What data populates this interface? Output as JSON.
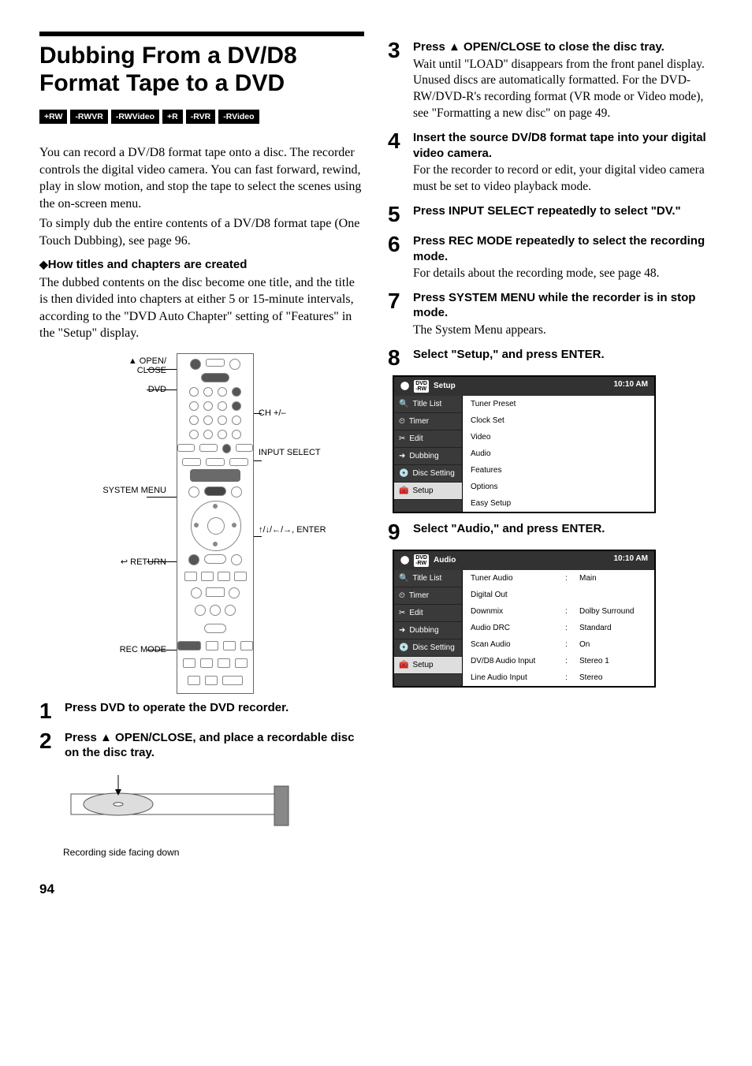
{
  "title": "Dubbing From a DV/D8 Format Tape to a DVD",
  "formats": [
    "+RW",
    "-RWVR",
    "-RWVideo",
    "+R",
    "-RVR",
    "-RVideo"
  ],
  "intro_p1": "You can record a DV/D8 format tape onto a disc. The recorder controls the digital video camera. You can fast forward, rewind, play in slow motion, and stop the tape to select the scenes using the on-screen menu.",
  "intro_p2": "To simply dub the entire contents of a DV/D8 format tape (One Touch Dubbing), see page 96.",
  "sub_heading": "How titles and chapters are created",
  "sub_text": "The dubbed contents on the disc become one title, and the title is then divided into chapters at either 5 or 15-minute intervals, according to the \"DVD Auto Chapter\" setting of \"Features\" in the \"Setup\" display.",
  "remote_labels": {
    "open_close": "OPEN/\nCLOSE",
    "dvd": "DVD",
    "ch": "CH +/–",
    "input_select": "INPUT SELECT",
    "system_menu": "SYSTEM MENU",
    "enter": "↑/↓/←/→, ENTER",
    "return": "RETURN",
    "rec_mode": "REC MODE"
  },
  "steps": {
    "s1": {
      "n": "1",
      "t": "Press DVD to operate the DVD recorder."
    },
    "s2": {
      "n": "2",
      "t": "Press ▲ OPEN/CLOSE, and place a recordable disc on the disc tray."
    },
    "s3": {
      "n": "3",
      "t": "Press ▲ OPEN/CLOSE to close the disc tray.",
      "b": "Wait until \"LOAD\" disappears from the front panel display.\nUnused discs are automatically formatted. For the DVD-RW/DVD-R's recording format (VR mode or Video mode), see \"Formatting a new disc\" on page 49."
    },
    "s4": {
      "n": "4",
      "t": "Insert the source DV/D8 format tape into your digital video camera.",
      "b": "For the recorder to record or edit, your digital video camera must be set to video playback mode."
    },
    "s5": {
      "n": "5",
      "t": "Press INPUT SELECT repeatedly to select \"DV.\""
    },
    "s6": {
      "n": "6",
      "t": "Press REC MODE repeatedly to select the recording mode.",
      "b": "For details about the recording mode, see page 48."
    },
    "s7": {
      "n": "7",
      "t": "Press SYSTEM MENU while the recorder is in stop mode.",
      "b": "The System Menu appears."
    },
    "s8": {
      "n": "8",
      "t": "Select \"Setup,\" and press ENTER."
    },
    "s9": {
      "n": "9",
      "t": "Select \"Audio,\" and press ENTER."
    }
  },
  "tray_caption": "Recording side facing down",
  "menu8": {
    "title": "Setup",
    "time": "10:10 AM",
    "sidebar": [
      "Title List",
      "Timer",
      "Edit",
      "Dubbing",
      "Disc Setting",
      "Setup"
    ],
    "active": 5,
    "rows": [
      {
        "k": "Tuner Preset"
      },
      {
        "k": "Clock Set"
      },
      {
        "k": "Video"
      },
      {
        "k": "Audio"
      },
      {
        "k": "Features"
      },
      {
        "k": "Options"
      },
      {
        "k": "Easy Setup"
      }
    ]
  },
  "menu9": {
    "title": "Audio",
    "time": "10:10 AM",
    "sidebar": [
      "Title List",
      "Timer",
      "Edit",
      "Dubbing",
      "Disc Setting",
      "Setup"
    ],
    "active": 5,
    "rows": [
      {
        "k": "Tuner Audio",
        "v": "Main"
      },
      {
        "k": "Digital Out"
      },
      {
        "k": "Downmix",
        "v": "Dolby Surround"
      },
      {
        "k": "Audio DRC",
        "v": "Standard"
      },
      {
        "k": "Scan Audio",
        "v": "On"
      },
      {
        "k": "DV/D8 Audio Input",
        "v": "Stereo 1"
      },
      {
        "k": "Line Audio Input",
        "v": "Stereo"
      }
    ]
  },
  "page_num": "94"
}
